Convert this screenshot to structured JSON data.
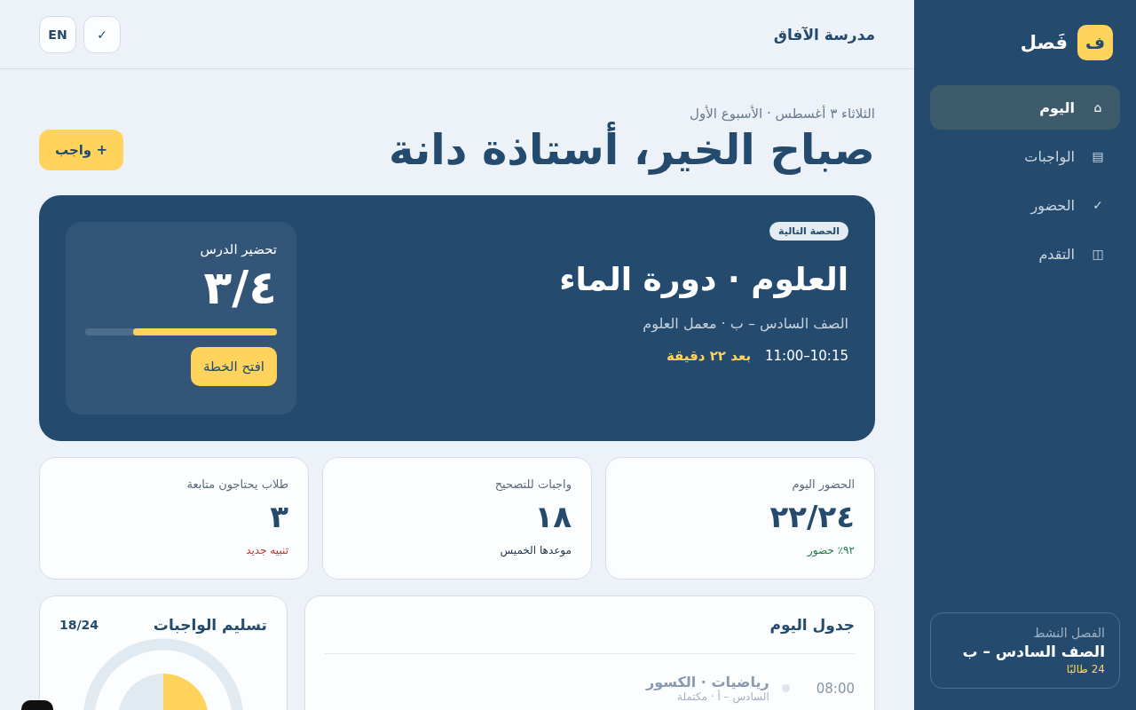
{
  "sidebar": {
    "brand": {
      "mark": "ف",
      "name": "فَصل"
    },
    "nav": [
      {
        "icon": "⌂",
        "label": "اليوم",
        "selected": true
      },
      {
        "icon": "▤",
        "label": "الواجبات",
        "selected": false
      },
      {
        "icon": "✓",
        "label": "الحضور",
        "selected": false
      },
      {
        "icon": "◫",
        "label": "التقدم",
        "selected": false
      }
    ],
    "active_class": {
      "label": "الفصل النشط",
      "name": "الصف السادس – ب",
      "count": "24 طالبًا"
    }
  },
  "top_bar": {
    "school": "مدرسة الآفاق",
    "buttons": [
      "✓",
      "EN"
    ]
  },
  "greeting": {
    "date": "الثلاثاء ٣ أغسطس · الأسبوع الأول",
    "title": "صباح الخير، أستاذة دانة",
    "button": "+ واجب"
  },
  "next_lesson": {
    "badge": "الحصة التالية",
    "title": "العلوم · دورة الماء",
    "subtitle": "الصف السادس – ب · معمل العلوم",
    "time": "10:15–11:00",
    "countdown": "بعد ٢٢ دقيقة",
    "prep": {
      "label": "تحضير الدرس",
      "value": "٣/٤",
      "level": 0.75,
      "button": "افتح الخطة"
    }
  },
  "stats": [
    {
      "label": "الحضور اليوم",
      "value": "٢٢/٢٤",
      "note": "٩٢٪ حضور",
      "color": "#1f7a45"
    },
    {
      "label": "واجبات للتصحيح",
      "value": "١٨",
      "note": "موعدها الخميس",
      "color": "#24364a"
    },
    {
      "label": "طلاب يحتاجون متابعة",
      "value": "٣",
      "note": "تنبيه جديد",
      "color": "#b8342c"
    }
  ],
  "schedule": {
    "title": "جدول اليوم",
    "rows": [
      {
        "time": "08:00",
        "title": "رياضيات · الكسور",
        "detail": "السادس – أ · مكتملة",
        "done": true
      }
    ]
  },
  "submissions": {
    "title": "تسليم الواجبات",
    "count": "18/24",
    "chart_data": {
      "type": "pie",
      "values": [
        75,
        25
      ]
    }
  }
}
